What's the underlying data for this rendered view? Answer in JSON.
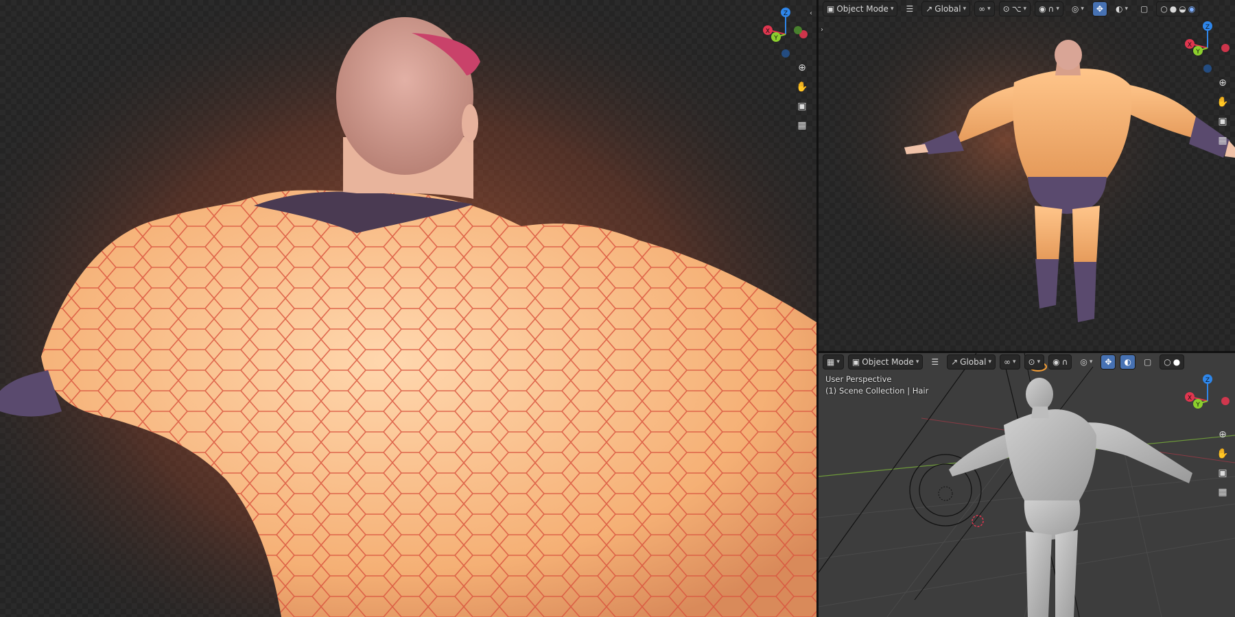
{
  "top_right_header": {
    "mode": "Object Mode",
    "orientation": "Global"
  },
  "bottom_right_header": {
    "mode": "Object Mode",
    "orientation": "Global"
  },
  "bottom_right_overlay": {
    "view_name": "User Perspective",
    "collection": "(1) Scene Collection | Hair"
  },
  "gizmo": {
    "x": "X",
    "y": "Y",
    "z": "Z"
  },
  "colors": {
    "x_axis": "#e0364f",
    "y_axis": "#8ccf2d",
    "z_axis": "#2e86ea",
    "accent": "#4772b3",
    "suit": "#f5b075",
    "hex_line": "#d9553f",
    "glove": "#5a4a6e"
  },
  "icons": [
    "zoom-icon",
    "hand-pan-icon",
    "camera-icon",
    "grid-ortho-icon",
    "menu-icon",
    "transform-icon",
    "link-icon",
    "snap-icon",
    "proportional-icon",
    "visibility-icon",
    "gizmo-icon",
    "overlay-icon",
    "xray-icon",
    "wireframe-shading-icon",
    "solid-shading-icon",
    "material-shading-icon",
    "rendered-shading-icon"
  ]
}
